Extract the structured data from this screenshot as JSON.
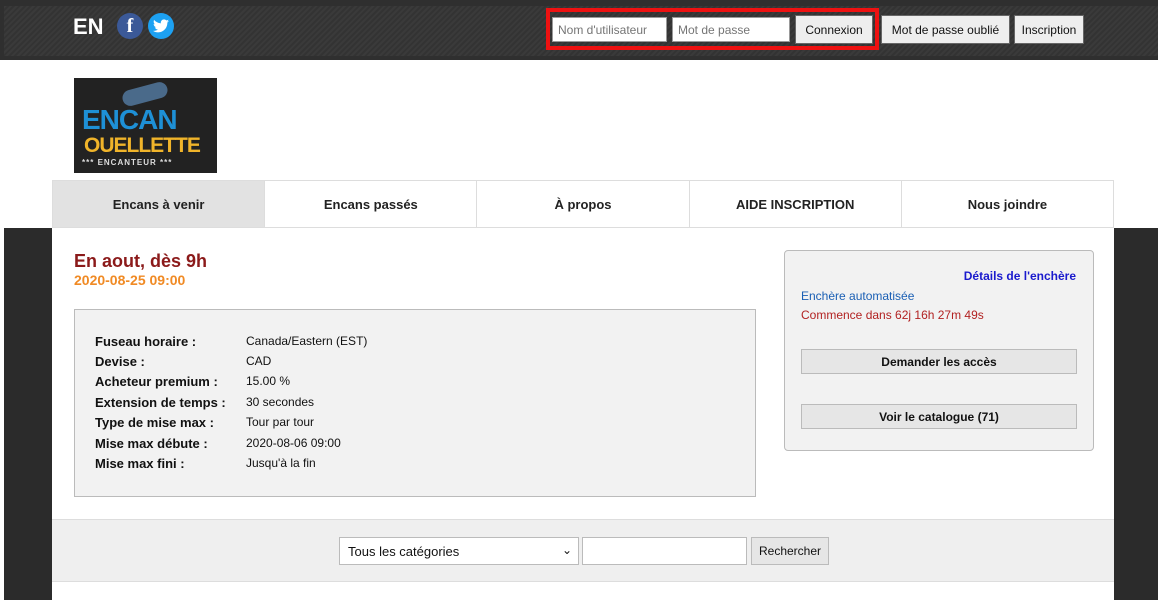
{
  "header": {
    "lang": "EN",
    "facebook_icon": "f",
    "twitter_icon": "twitter-bird",
    "username_placeholder": "Nom d'utilisateur",
    "password_placeholder": "Mot de passe",
    "login_label": "Connexion",
    "forgot_label": "Mot de passe oublié",
    "register_label": "Inscription"
  },
  "logo": {
    "line1": "ENCAN",
    "line2": "OUELLETTE",
    "line3": "*** ENCANTEUR ***"
  },
  "nav": {
    "tabs": [
      {
        "label": "Encans à venir"
      },
      {
        "label": "Encans passés"
      },
      {
        "label": "À propos"
      },
      {
        "label": "AIDE INSCRIPTION"
      },
      {
        "label": "Nous joindre"
      }
    ]
  },
  "auction": {
    "title": "En aout, dès 9h",
    "date": "2020-08-25 09:00",
    "info": [
      {
        "label": "Fuseau horaire :",
        "value": "Canada/Eastern (EST)"
      },
      {
        "label": "Devise :",
        "value": "CAD"
      },
      {
        "label": "Acheteur premium :",
        "value": "15.00 %"
      },
      {
        "label": "Extension de temps :",
        "value": "30 secondes"
      },
      {
        "label": "Type de mise max :",
        "value": "Tour par tour"
      },
      {
        "label": "Mise max débute :",
        "value": "2020-08-06 09:00"
      },
      {
        "label": "Mise max fini :",
        "value": "Jusqu'à la fin"
      }
    ],
    "details_link": "Détails de l'enchère",
    "type": "Enchère automatisée",
    "countdown": "Commence dans 62j 16h 27m 49s",
    "request_access_label": "Demander les accès",
    "catalog_label": "Voir le catalogue (71)"
  },
  "search": {
    "category_selected": "Tous les catégories",
    "button_label": "Rechercher"
  },
  "colors": {
    "title": "#8b1a1a",
    "date": "#f08a24",
    "highlight_border": "#ee1111"
  }
}
